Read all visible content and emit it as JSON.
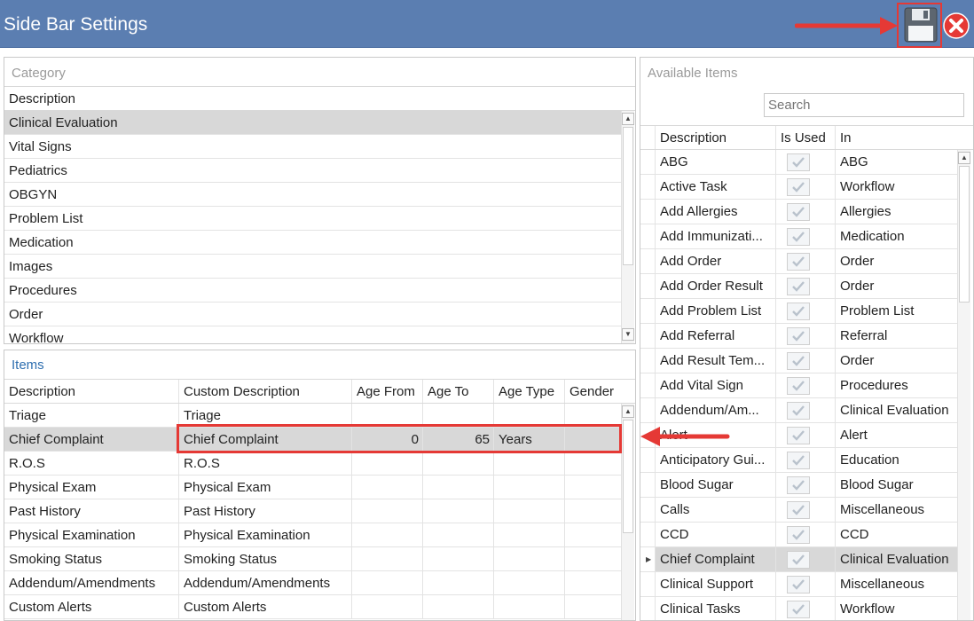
{
  "window": {
    "title": "Side Bar Settings"
  },
  "icons": {
    "save": "floppy-disk-icon",
    "close": "close-circle-icon",
    "sort": "sort-ascending-icon"
  },
  "colors": {
    "titlebar": "#5b7eb1",
    "highlight": "#e53935",
    "selected_row": "#d8d8d8"
  },
  "category": {
    "title": "Category",
    "header": "Description",
    "rows": [
      "Clinical Evaluation",
      "Vital Signs",
      "Pediatrics",
      "OBGYN",
      "Problem List",
      "Medication",
      "Images",
      "Procedures",
      "Order",
      "Workflow"
    ],
    "selected_index": 0
  },
  "items": {
    "title": "Items",
    "headers": [
      "Description",
      "Custom Description",
      "Age From",
      "Age To",
      "Age Type",
      "Gender"
    ],
    "rows": [
      [
        "Triage",
        "Triage",
        "",
        "",
        "",
        ""
      ],
      [
        "Chief Complaint",
        "Chief Complaint",
        "0",
        "65",
        "Years",
        ""
      ],
      [
        "R.O.S",
        "R.O.S",
        "",
        "",
        "",
        ""
      ],
      [
        "Physical Exam",
        "Physical Exam",
        "",
        "",
        "",
        ""
      ],
      [
        "Past History",
        "Past History",
        "",
        "",
        "",
        ""
      ],
      [
        "Physical Examination",
        "Physical Examination",
        "",
        "",
        "",
        ""
      ],
      [
        "Smoking Status",
        "Smoking Status",
        "",
        "",
        "",
        ""
      ],
      [
        "Addendum/Amendments",
        "Addendum/Amendments",
        "",
        "",
        "",
        ""
      ],
      [
        "Custom Alerts",
        "Custom Alerts",
        "",
        "",
        "",
        ""
      ]
    ],
    "selected_index": 1
  },
  "available": {
    "title": "Available Items",
    "search_placeholder": "Search",
    "headers": [
      "Description",
      "Is Used",
      "In"
    ],
    "rows": [
      [
        "ABG",
        true,
        "ABG"
      ],
      [
        "Active Task",
        true,
        "Workflow"
      ],
      [
        "Add Allergies",
        true,
        "Allergies"
      ],
      [
        "Add Immunizati...",
        true,
        "Medication"
      ],
      [
        "Add Order",
        true,
        "Order"
      ],
      [
        "Add Order Result",
        true,
        "Order"
      ],
      [
        "Add Problem List",
        true,
        "Problem List"
      ],
      [
        "Add Referral",
        true,
        "Referral"
      ],
      [
        "Add Result Tem...",
        true,
        "Order"
      ],
      [
        "Add Vital Sign",
        true,
        "Procedures"
      ],
      [
        "Addendum/Am...",
        true,
        "Clinical Evaluation"
      ],
      [
        "Alert",
        true,
        "Alert"
      ],
      [
        "Anticipatory Gui...",
        true,
        "Education"
      ],
      [
        "Blood Sugar",
        true,
        "Blood Sugar"
      ],
      [
        "Calls",
        true,
        "Miscellaneous"
      ],
      [
        "CCD",
        true,
        "CCD"
      ],
      [
        "Chief Complaint",
        true,
        "Clinical Evaluation"
      ],
      [
        "Clinical Support",
        true,
        "Miscellaneous"
      ],
      [
        "Clinical Tasks",
        true,
        "Workflow"
      ]
    ],
    "selected_index": 16
  }
}
